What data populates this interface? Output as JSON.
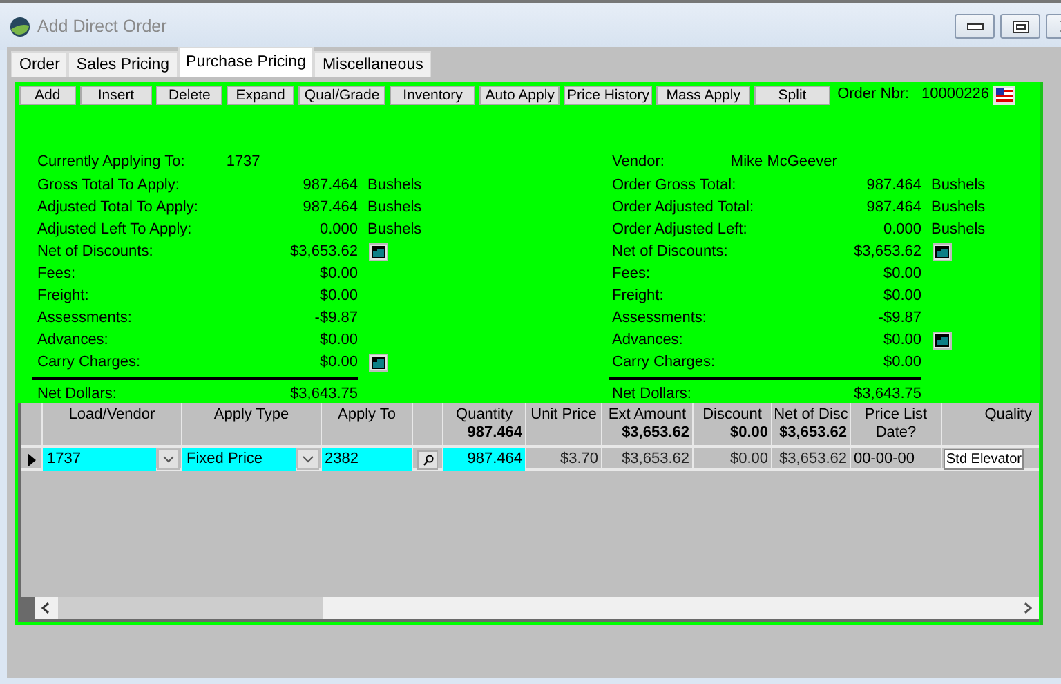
{
  "window": {
    "title": "Add Direct Order"
  },
  "tabs": [
    {
      "label": "Order",
      "selected": false
    },
    {
      "label": "Sales Pricing",
      "selected": false
    },
    {
      "label": "Purchase Pricing",
      "selected": true
    },
    {
      "label": "Miscellaneous",
      "selected": false
    }
  ],
  "toolbar": {
    "buttons": [
      "Add",
      "Insert",
      "Delete",
      "Expand",
      "Qual/Grade",
      "Inventory",
      "Auto Apply",
      "Price History",
      "Mass Apply",
      "Split"
    ],
    "order_label": "Order Nbr:",
    "order_number": "10000226"
  },
  "summary_left": {
    "header": {
      "label": "Currently Applying To:",
      "value": "1737"
    },
    "rows": [
      {
        "label": "Gross Total To Apply:",
        "value": "987.464",
        "unit": "Bushels",
        "detail_button": false
      },
      {
        "label": "Adjusted Total To Apply:",
        "value": "987.464",
        "unit": "Bushels",
        "detail_button": false
      },
      {
        "label": "Adjusted Left To Apply:",
        "value": "0.000",
        "unit": "Bushels",
        "detail_button": false
      },
      {
        "label": "Net of Discounts:",
        "value": "$3,653.62",
        "detail_button": true
      },
      {
        "label": "Fees:",
        "value": "$0.00",
        "detail_button": false
      },
      {
        "label": "Freight:",
        "value": "$0.00",
        "detail_button": false
      },
      {
        "label": "Assessments:",
        "value": "-$9.87",
        "detail_button": false
      },
      {
        "label": "Advances:",
        "value": "$0.00",
        "detail_button": false
      },
      {
        "label": "Carry Charges:",
        "value": "$0.00",
        "detail_button": true
      }
    ],
    "total": {
      "label": "Net Dollars:",
      "value": "$3,643.75"
    }
  },
  "summary_right": {
    "header": {
      "label": "Vendor:",
      "value": "Mike McGeever"
    },
    "rows": [
      {
        "label": "Order Gross Total:",
        "value": "987.464",
        "unit": "Bushels",
        "detail_button": false
      },
      {
        "label": "Order Adjusted Total:",
        "value": "987.464",
        "unit": "Bushels",
        "detail_button": false
      },
      {
        "label": "Order Adjusted Left:",
        "value": "0.000",
        "unit": "Bushels",
        "detail_button": false
      },
      {
        "label": "Net of Discounts:",
        "value": "$3,653.62",
        "detail_button": true
      },
      {
        "label": "Fees:",
        "value": "$0.00",
        "detail_button": false
      },
      {
        "label": "Freight:",
        "value": "$0.00",
        "detail_button": false
      },
      {
        "label": "Assessments:",
        "value": "-$9.87",
        "detail_button": false
      },
      {
        "label": "Advances:",
        "value": "$0.00",
        "detail_button": true
      },
      {
        "label": "Carry Charges:",
        "value": "$0.00",
        "detail_button": false
      }
    ],
    "total": {
      "label": "Net Dollars:",
      "value": "$3,643.75"
    }
  },
  "grid": {
    "columns": [
      {
        "label": "Load/Vendor"
      },
      {
        "label": "Apply Type"
      },
      {
        "label": "Apply To"
      },
      {},
      {
        "label": "Quantity",
        "total": "987.464"
      },
      {
        "label": "Unit Price"
      },
      {
        "label": "Ext Amount",
        "total": "$3,653.62"
      },
      {
        "label": "Discount",
        "total": "$0.00"
      },
      {
        "label": "Net of Disc",
        "total": "$3,653.62"
      },
      {
        "label": "Price List Date?"
      },
      {
        "label": "Quality"
      }
    ],
    "rows": [
      {
        "selected": true,
        "cells": [
          {
            "kind": "combo",
            "value": "1737",
            "highlighted": true
          },
          {
            "kind": "combo",
            "value": "Fixed Price",
            "highlighted": true
          },
          {
            "kind": "field",
            "value": "2382",
            "highlighted": true
          },
          {
            "kind": "lookup"
          },
          {
            "kind": "number",
            "value": "987.464",
            "highlighted": true
          },
          {
            "kind": "number",
            "value": "$3.70",
            "highlighted": false
          },
          {
            "kind": "number",
            "value": "$3,653.62",
            "highlighted": false
          },
          {
            "kind": "number",
            "value": "$0.00",
            "highlighted": false
          },
          {
            "kind": "number",
            "value": "$3,653.62",
            "highlighted": false
          },
          {
            "kind": "field",
            "value": "00-00-00",
            "highlighted": false
          },
          {
            "kind": "input",
            "value": "Std Elevator"
          }
        ]
      }
    ]
  }
}
